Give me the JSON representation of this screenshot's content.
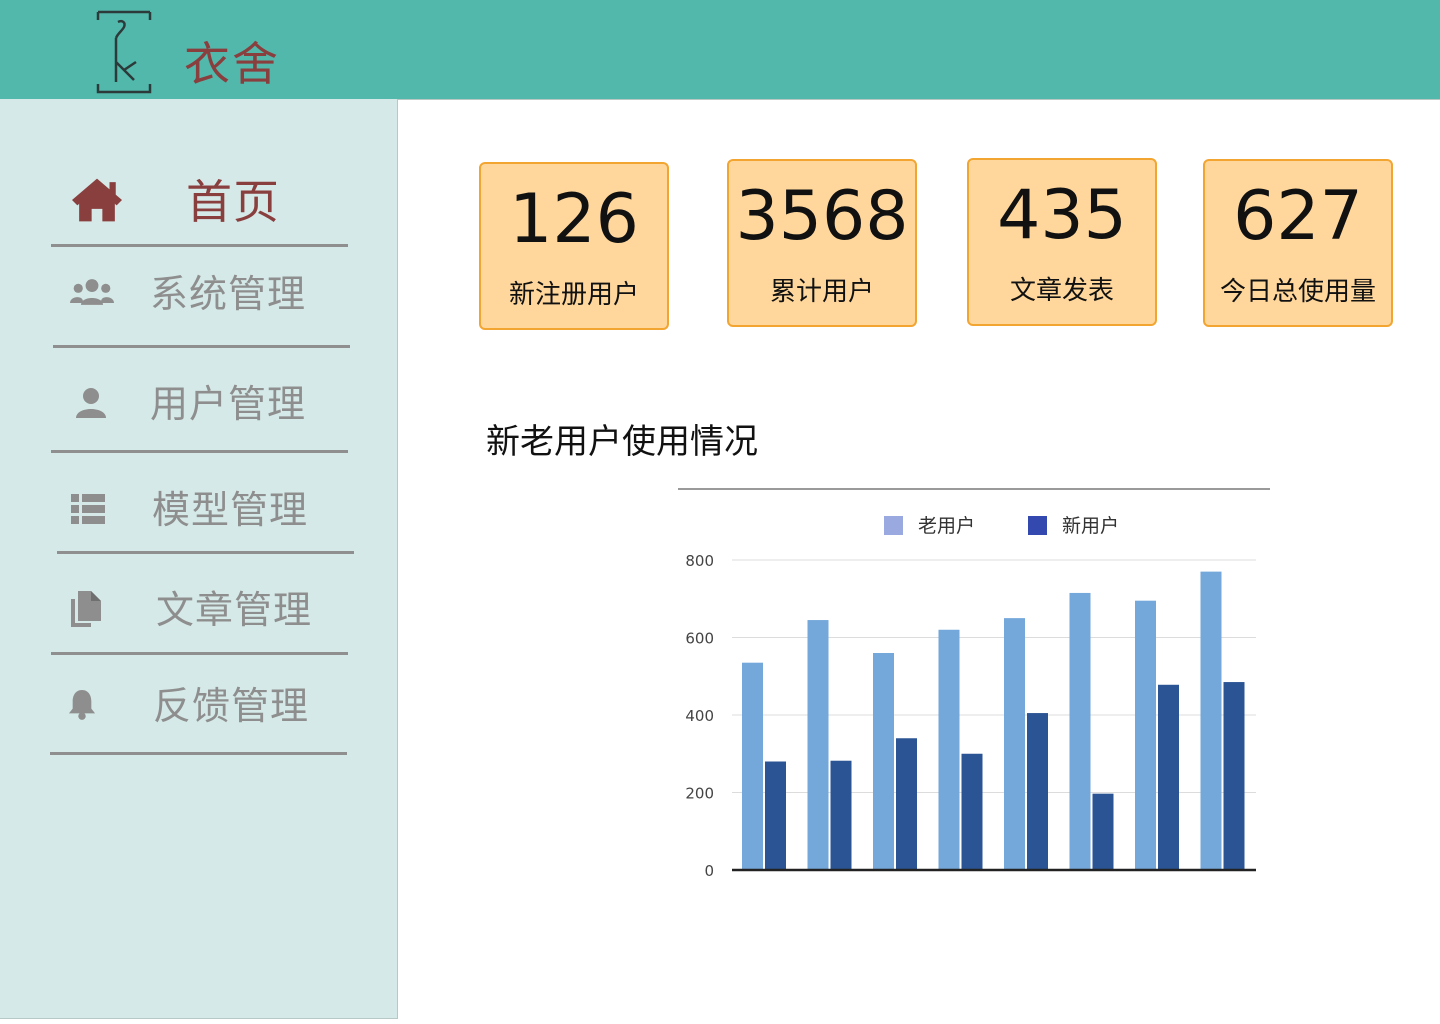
{
  "header": {
    "brand": "衣舍",
    "logo_icon": "hanger-logo-icon",
    "background": "#52b8ac",
    "brand_color": "#8a3f3f"
  },
  "sidebar": {
    "background": "#d5eae8",
    "items": [
      {
        "label": "首页",
        "icon": "home-icon",
        "active": true
      },
      {
        "label": "系统管理",
        "icon": "users-icon",
        "active": false
      },
      {
        "label": "用户管理",
        "icon": "user-icon",
        "active": false
      },
      {
        "label": "模型管理",
        "icon": "list-icon",
        "active": false
      },
      {
        "label": "文章管理",
        "icon": "copy-documents-icon",
        "active": false
      },
      {
        "label": "反馈管理",
        "icon": "bell-icon",
        "active": false
      }
    ]
  },
  "stats": [
    {
      "value": "126",
      "label": "新注册用户"
    },
    {
      "value": "3568",
      "label": "累计用户"
    },
    {
      "value": "435",
      "label": "文章发表"
    },
    {
      "value": "627",
      "label": "今日总使用量"
    }
  ],
  "section": {
    "title": "新老用户使用情况"
  },
  "chart_data": {
    "type": "bar",
    "categories": [
      "",
      "",
      "",
      "",
      "",
      "",
      "",
      ""
    ],
    "series": [
      {
        "name": "老用户",
        "values": [
          535,
          645,
          560,
          620,
          650,
          715,
          695,
          770
        ],
        "color": "#74a7da",
        "legend_color": "#9aa9df"
      },
      {
        "name": "新用户",
        "values": [
          280,
          282,
          340,
          300,
          405,
          197,
          478,
          485
        ],
        "color": "#2b5494",
        "legend_color": "#3449b0"
      }
    ],
    "yticks": [
      0,
      200,
      400,
      600,
      800
    ],
    "ylim": [
      0,
      800
    ],
    "grid": true,
    "legend_position": "top"
  }
}
